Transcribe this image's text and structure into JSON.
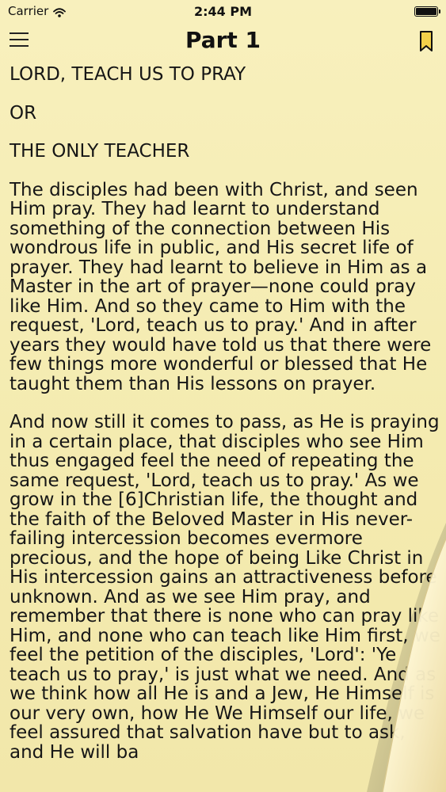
{
  "status_bar": {
    "carrier": "Carrier",
    "time": "2:44 PM",
    "wifi_icon": "wifi-icon",
    "battery_icon": "battery-icon"
  },
  "nav": {
    "menu_icon": "menu-icon",
    "title": "Part 1",
    "bookmark_icon": "bookmark-icon"
  },
  "content": {
    "heading_1": "LORD, TEACH US TO PRAY",
    "heading_2": "OR",
    "heading_3": "THE ONLY TEACHER",
    "paragraph_1": "The disciples had been with Christ, and seen Him pray. They had learnt to understand something of the connection between His wondrous life in public, and His secret life of prayer. They had learnt to believe in Him as a Master in the art of prayer—none could pray like Him. And so they came to Him with the request, 'Lord, teach us to pray.' And in after years they would have told us that there were few things more wonderful or blessed that He taught them than His lessons on prayer.",
    "paragraph_2": "And now still it comes to pass, as He is praying in a certain place, that disciples who see Him thus engaged feel the need of repeating the same request, 'Lord, teach us to pray.' As we grow in the [6]Christian life, the thought and the faith of the Beloved Master in His never-failing intercession becomes evermore precious, and the hope of being Like Christ in His intercession gains an attractiveness before unknown. And as we see Him pray, and remember that there is none who can pray like Him, and none who can teach like Him first, we feel the petition of the disciples, 'Lord': 'Ye teach us to pray,' is just what we need. And as we think how all He is and a Jew, He Himself is our very own, how He We Himself our life, we feel assured that salvation have but to ask, and He will ba"
  },
  "colors": {
    "page_background": "#f6eeb3",
    "text": "#161616",
    "bookmark_fill": "#f2d04a"
  }
}
